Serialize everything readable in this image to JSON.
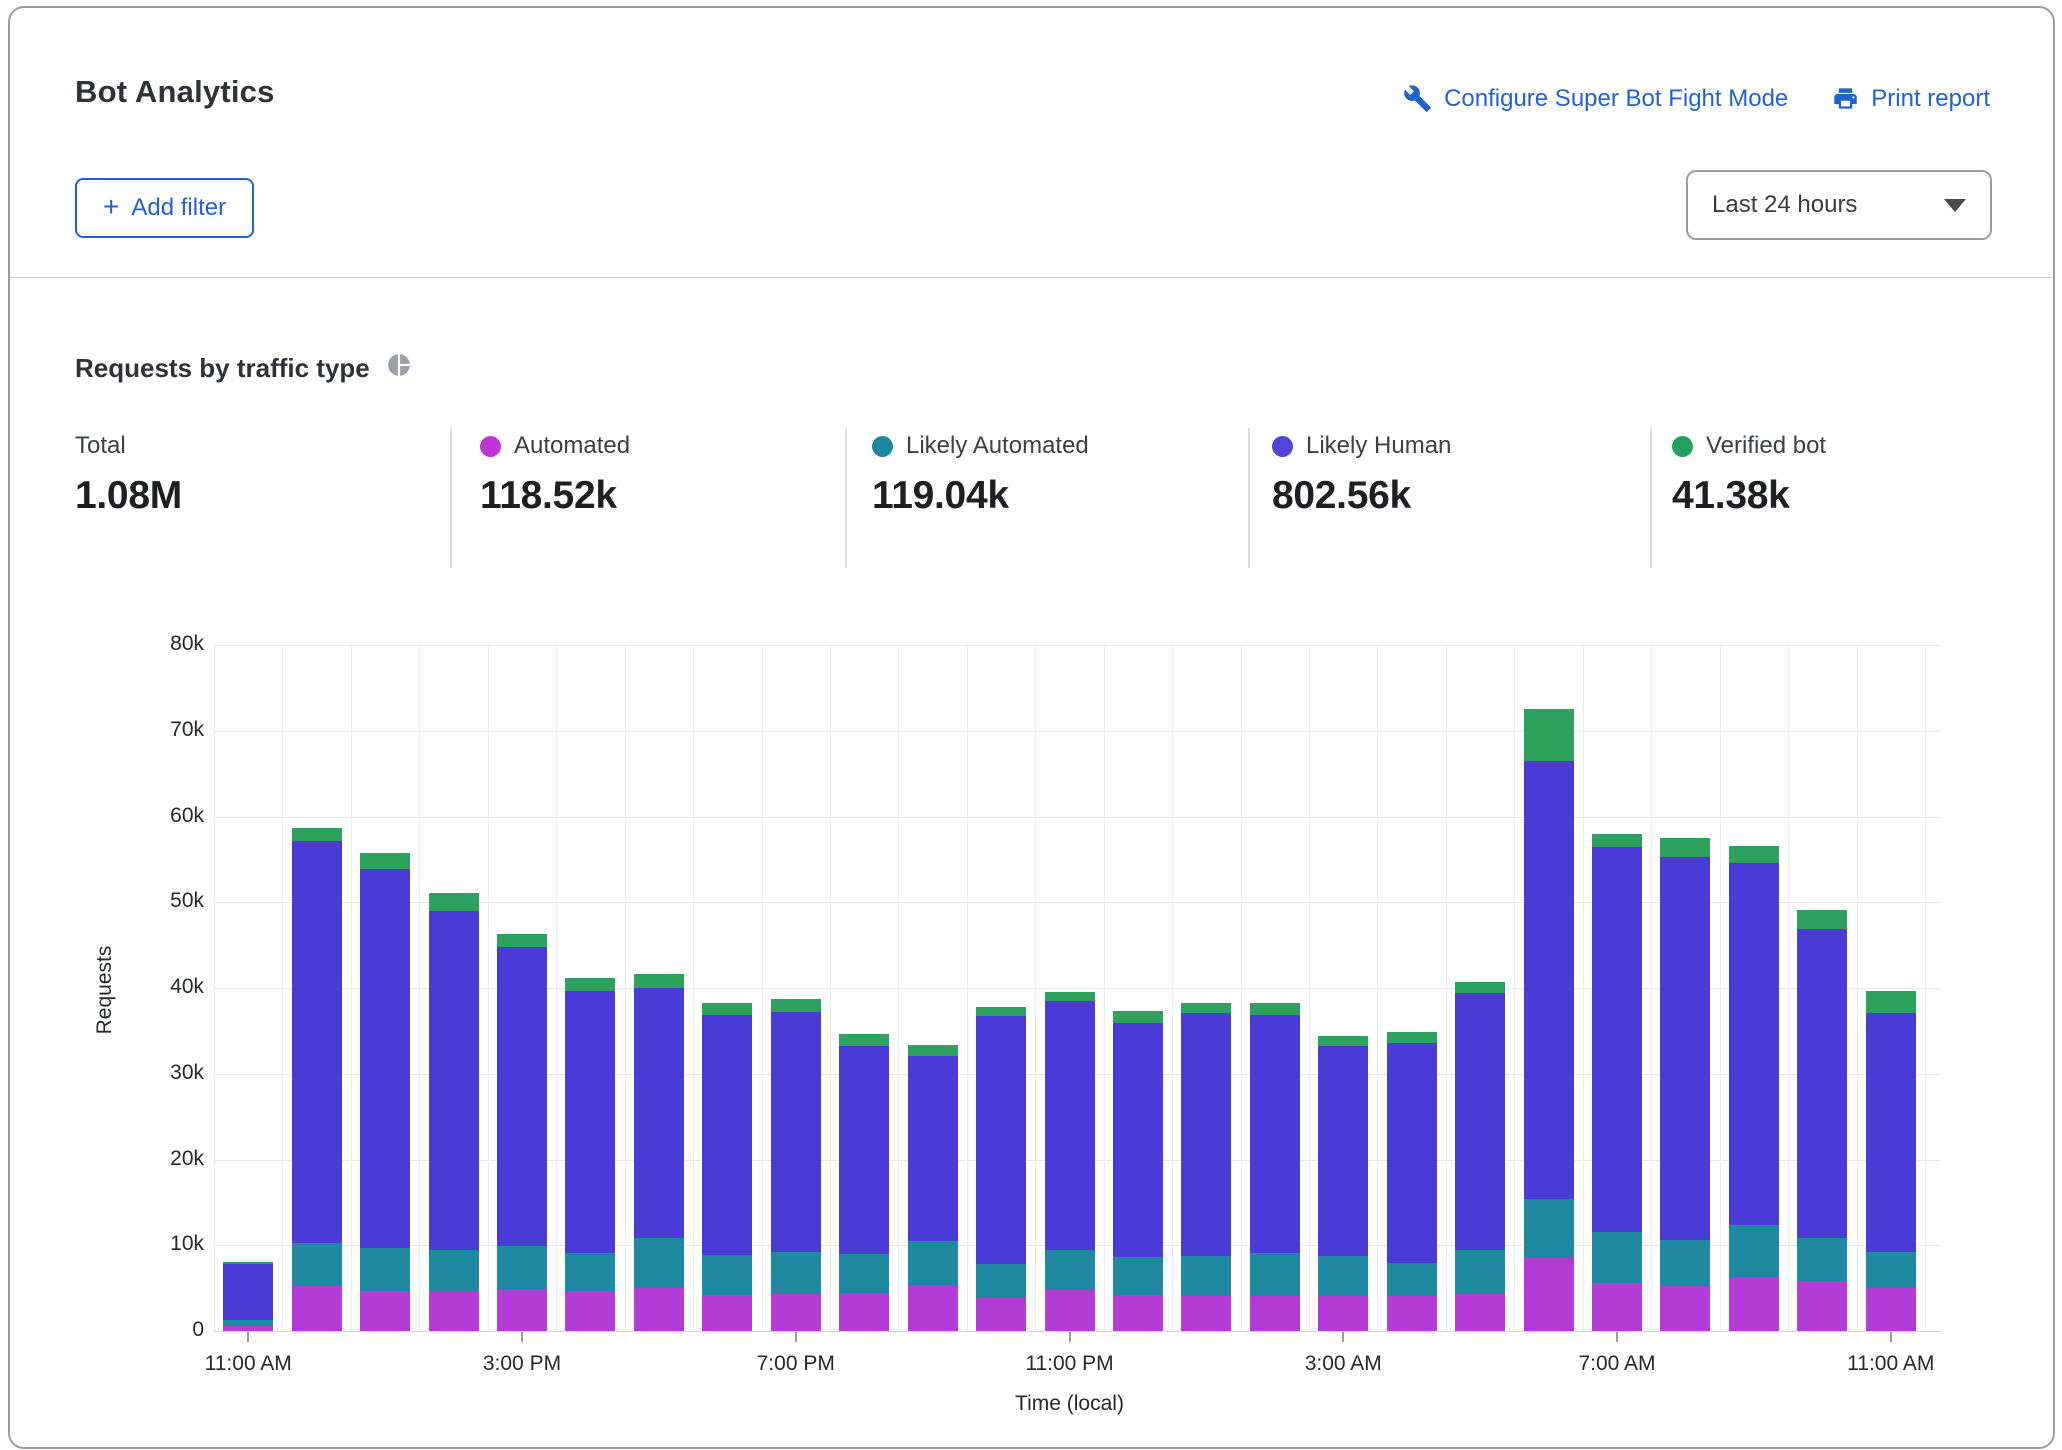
{
  "header": {
    "title": "Bot Analytics",
    "configure_link": "Configure Super Bot Fight Mode",
    "print_link": "Print report",
    "add_filter_plus": "+",
    "add_filter_label": "Add filter",
    "time_range_value": "Last 24 hours"
  },
  "section": {
    "title": "Requests by traffic type"
  },
  "stats": {
    "items": [
      {
        "label": "Total",
        "value": "1.08M",
        "color": null
      },
      {
        "label": "Automated",
        "value": "118.52k",
        "color": "#bf35da"
      },
      {
        "label": "Likely Automated",
        "value": "119.04k",
        "color": "#1b87a0"
      },
      {
        "label": "Likely Human",
        "value": "802.56k",
        "color": "#5044db"
      },
      {
        "label": "Verified bot",
        "value": "41.38k",
        "color": "#22a35b"
      }
    ]
  },
  "chart_data": {
    "type": "bar",
    "stacked": true,
    "title": "Requests by traffic type",
    "xlabel": "Time (local)",
    "ylabel": "Requests",
    "values_unit": "thousands of requests (k)",
    "ylim_k": [
      0,
      80
    ],
    "y_ticks": [
      "0",
      "10k",
      "20k",
      "30k",
      "40k",
      "50k",
      "60k",
      "70k",
      "80k"
    ],
    "x_tick_labels": [
      "11:00 AM",
      "3:00 PM",
      "7:00 PM",
      "11:00 PM",
      "3:00 AM",
      "7:00 AM",
      "11:00 AM"
    ],
    "x_tick_indices": [
      0,
      4,
      8,
      12,
      16,
      20,
      24
    ],
    "grid": true,
    "legend_position": "stats-row-above-chart",
    "series": [
      {
        "name": "Automated",
        "color": "#b33bd6",
        "values_k": [
          0.6,
          5.2,
          4.7,
          4.6,
          4.9,
          4.7,
          5.0,
          4.2,
          4.3,
          4.4,
          5.4,
          3.8,
          4.8,
          4.2,
          4.1,
          4.1,
          4.1,
          4.1,
          4.3,
          8.5,
          5.6,
          5.3,
          6.3,
          5.8,
          5.0
        ]
      },
      {
        "name": "Likely Automated",
        "color": "#2089a2",
        "values_k": [
          0.7,
          5.1,
          5.0,
          4.9,
          5.0,
          4.4,
          5.8,
          4.7,
          4.9,
          4.6,
          5.1,
          4.0,
          4.7,
          4.4,
          4.7,
          5.0,
          4.7,
          3.8,
          5.2,
          6.9,
          6.0,
          5.3,
          6.1,
          5.1,
          4.2
        ]
      },
      {
        "name": "Likely Human",
        "color": "#4a3bd7",
        "values_k": [
          6.5,
          46.9,
          44.2,
          39.5,
          34.9,
          30.5,
          29.2,
          27.9,
          28.0,
          24.2,
          21.6,
          28.9,
          29.0,
          27.3,
          28.3,
          27.8,
          24.4,
          25.7,
          29.9,
          51.1,
          44.8,
          44.7,
          42.2,
          36.0,
          27.9
        ]
      },
      {
        "name": "Verified bot",
        "color": "#2ca25e",
        "values_k": [
          0.3,
          1.5,
          1.8,
          2.1,
          1.5,
          1.6,
          1.6,
          1.5,
          1.5,
          1.4,
          1.2,
          1.1,
          1.0,
          1.4,
          1.1,
          1.3,
          1.2,
          1.3,
          1.3,
          6.0,
          1.6,
          2.2,
          2.0,
          2.2,
          2.5
        ]
      }
    ]
  }
}
